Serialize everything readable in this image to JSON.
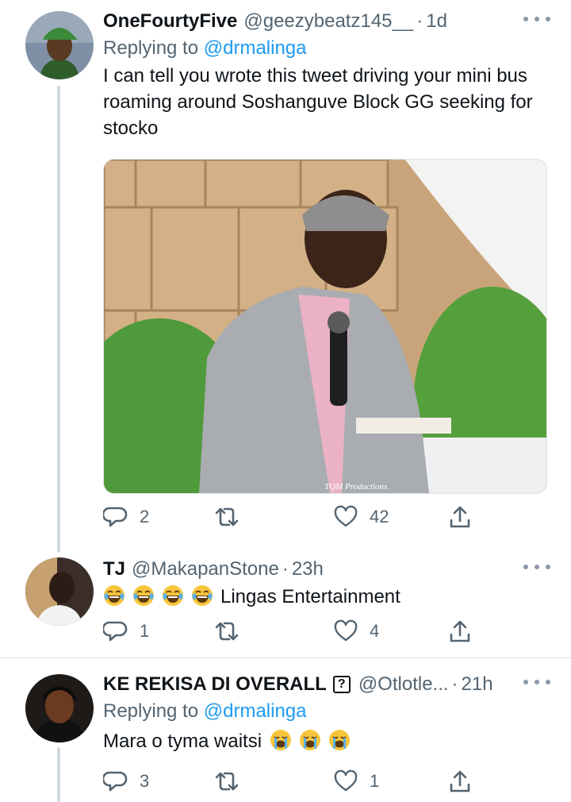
{
  "tweets": [
    {
      "name": "OneFourtyFive",
      "handle": "@geezybeatz145__",
      "time": "1d",
      "replying_prefix": "Replying to",
      "replying_to": "@drmalinga",
      "text": "I can tell you wrote this tweet driving your mini bus roaming around Soshanguve Block GG seeking for stocko",
      "image_caption": "TQM Productions",
      "replies": "2",
      "retweets": "",
      "likes": "42"
    },
    {
      "name": "TJ",
      "handle": "@MakapanStone",
      "time": "23h",
      "text": "Lingas Entertainment",
      "emoji_count": 4,
      "replies": "1",
      "retweets": "",
      "likes": "4"
    },
    {
      "name": "KE REKISA DI OVERALL",
      "name_badge": "?",
      "handle": "@Otlotle...",
      "time": "21h",
      "replying_prefix": "Replying to",
      "replying_to": "@drmalinga",
      "text": "Mara o tyma waitsi",
      "emoji_count": 3,
      "replies": "3",
      "retweets": "",
      "likes": "1"
    }
  ],
  "colors": {
    "accent": "#1d9bf0",
    "secondary_text": "#536471",
    "thread_line": "#cfd9de"
  },
  "icons": [
    "reply-icon",
    "retweet-icon",
    "like-icon",
    "share-icon",
    "more-icon"
  ]
}
